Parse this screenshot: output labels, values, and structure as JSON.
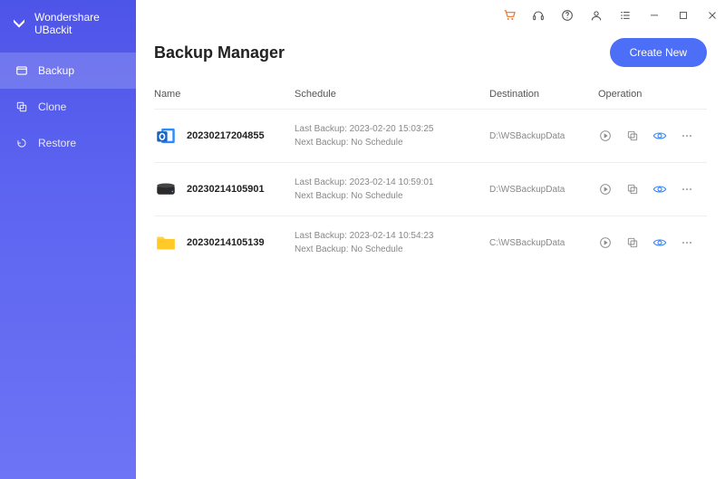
{
  "app_title": "Wondershare UBackit",
  "sidebar": {
    "items": [
      {
        "label": "Backup"
      },
      {
        "label": "Clone"
      },
      {
        "label": "Restore"
      }
    ]
  },
  "page": {
    "title": "Backup Manager",
    "create_label": "Create New"
  },
  "columns": {
    "name": "Name",
    "schedule": "Schedule",
    "destination": "Destination",
    "operation": "Operation"
  },
  "tasks": [
    {
      "icon": "outlook",
      "name": "20230217204855",
      "last_label": "Last Backup: ",
      "last_value": "2023-02-20 15:03:25",
      "next_label": "Next Backup: ",
      "next_value": "No Schedule",
      "destination": "D:\\WSBackupData"
    },
    {
      "icon": "disk",
      "name": "20230214105901",
      "last_label": "Last Backup: ",
      "last_value": "2023-02-14 10:59:01",
      "next_label": "Next Backup: ",
      "next_value": "No Schedule",
      "destination": "D:\\WSBackupData"
    },
    {
      "icon": "folder",
      "name": "20230214105139",
      "last_label": "Last Backup: ",
      "last_value": "2023-02-14 10:54:23",
      "next_label": "Next Backup: ",
      "next_value": "No Schedule",
      "destination": "C:\\WSBackupData"
    }
  ]
}
